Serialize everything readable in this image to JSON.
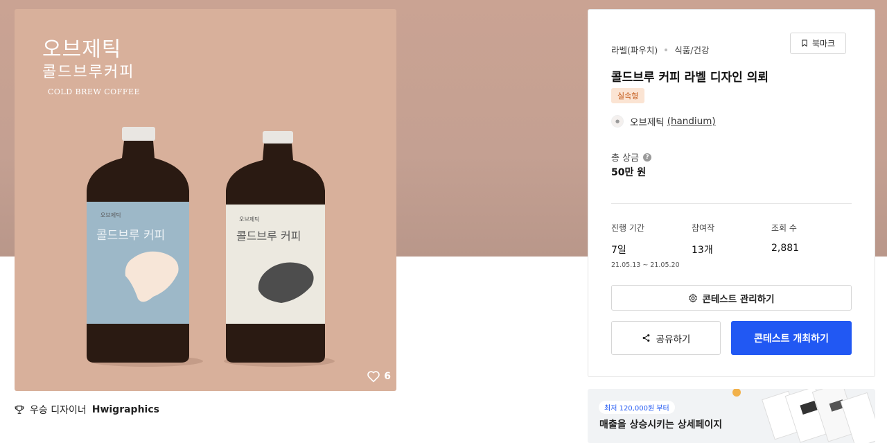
{
  "product": {
    "brand_title_line1": "오브제틱",
    "brand_title_line2": "콜드브루커피",
    "brand_title_line3": "COLD BREW COFFEE",
    "bottle_left_label": "콜드브루 커피",
    "bottle_left_small": "오브제틱",
    "bottle_right_label": "콜드브루 커피",
    "bottle_right_small": "오브제틱",
    "like_count": "6"
  },
  "winner": {
    "label": "우승 디자이너",
    "name": "Hwigraphics"
  },
  "panel": {
    "category_main": "라벨(파우치)",
    "category_sub": "식품/건강",
    "bookmark_label": "북마크",
    "title": "콜드브루 커피 라벨 디자인 의뢰",
    "type_badge": "실속형",
    "host_name": "오브제틱",
    "host_id": "(handium)",
    "prize_label": "총 상금",
    "prize_value": "50만 원",
    "stats": {
      "period_label": "진행 기간",
      "period_value": "7일",
      "period_dates": "21.05.13 ~ 21.05.20",
      "entries_label": "참여작",
      "entries_value": "13개",
      "views_label": "조회 수",
      "views_value": "2,881"
    },
    "manage_button": "콘테스트 관리하기",
    "share_button": "공유하기",
    "host_button": "콘테스트 개최하기"
  },
  "ad": {
    "pill": "최저 120,000원 부터",
    "headline": "매출을 상승시키는 상세페이지"
  },
  "colors": {
    "hero_bg": "#c4a092",
    "image_bg": "#d8b09b",
    "primary": "#2158f3",
    "badge_bg": "#fbe4d3",
    "badge_text": "#c45a1a",
    "label_blue": "#9db8c8",
    "label_cream": "#ece9e0"
  }
}
